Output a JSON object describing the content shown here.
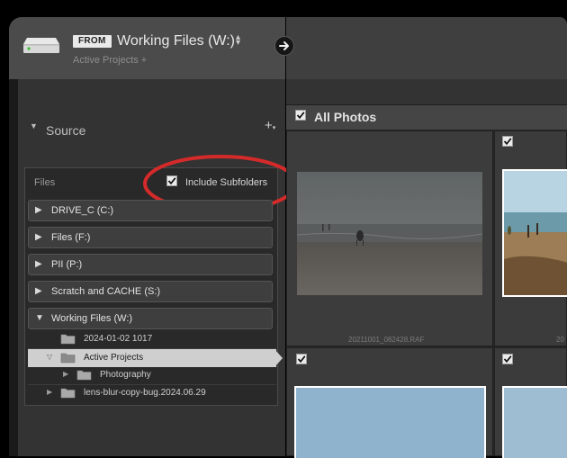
{
  "header": {
    "from_badge": "FROM",
    "source_name": "Working Files (W:)",
    "sort_icon": "up-down-arrows-icon",
    "sub_path": "Active Projects +"
  },
  "source_panel": {
    "title": "Source",
    "add_icon": "plus-icon",
    "files_label": "Files",
    "include_subfolders_label": "Include Subfolders",
    "include_subfolders_checked": true,
    "volumes": [
      {
        "label": "DRIVE_C (C:)",
        "expanded": false
      },
      {
        "label": "Files (F:)",
        "expanded": false
      },
      {
        "label": "PII (P:)",
        "expanded": false
      },
      {
        "label": "Scratch and CACHE (S:)",
        "expanded": false
      },
      {
        "label": "Working Files (W:)",
        "expanded": true
      }
    ],
    "folders": [
      {
        "label": "2024-01-02 1017",
        "selected": false
      },
      {
        "label": "Active Projects",
        "selected": true
      },
      {
        "label": "Photography",
        "selected": false
      },
      {
        "label": "lens-blur-copy-bug.2024.06.29",
        "selected": false
      }
    ]
  },
  "grid": {
    "title": "All Photos",
    "all_checked": true,
    "items": [
      {
        "filename": "20211001_082428.RAF",
        "checked": false
      },
      {
        "filename": "20",
        "checked": true
      },
      {
        "filename": "",
        "checked": true
      },
      {
        "filename": "",
        "checked": true
      }
    ]
  },
  "colors": {
    "highlight_ellipse": "#d42a2a",
    "selected_row": "#cfcfcf"
  }
}
